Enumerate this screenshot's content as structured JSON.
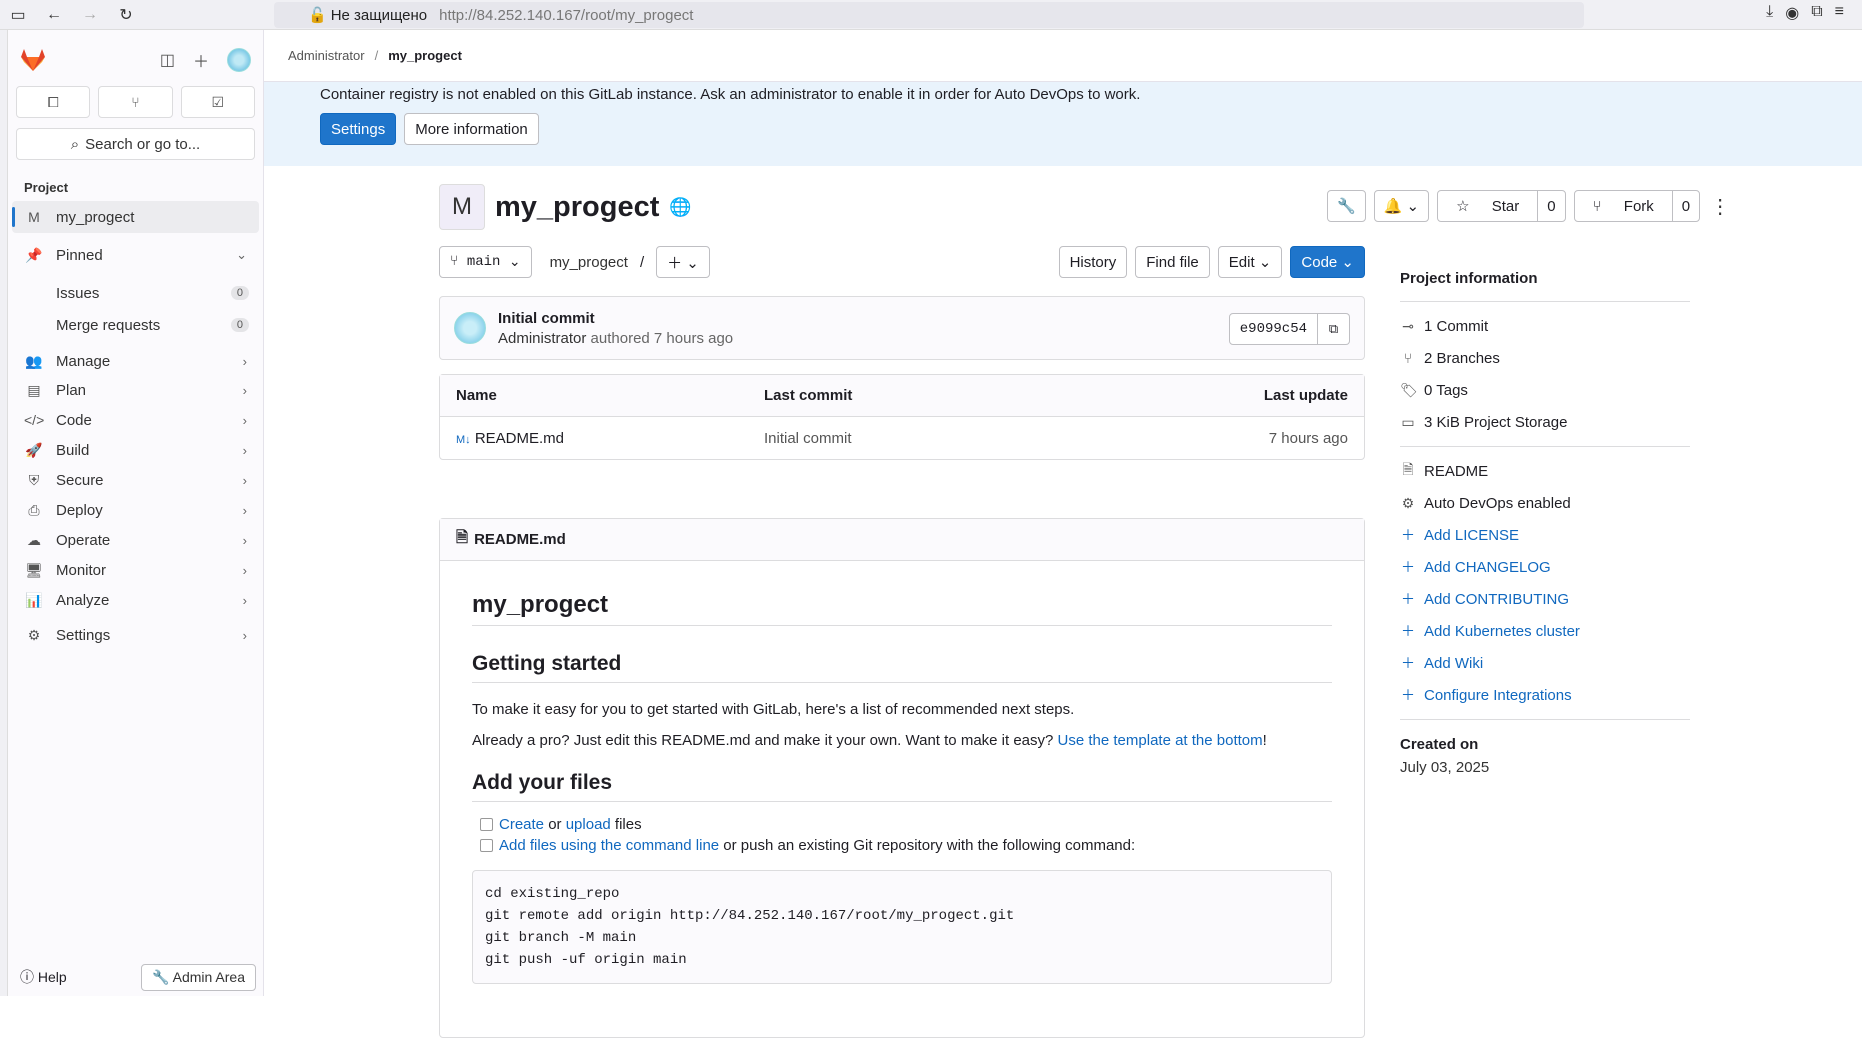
{
  "browser": {
    "security_label": "Не защищено",
    "url": "http://84.252.140.167/root/my_progect"
  },
  "sidebar": {
    "search": "Search or go to...",
    "section": "Project",
    "project_item": "my_progect",
    "project_initial": "M",
    "pinned": "Pinned",
    "issues": "Issues",
    "issues_count": "0",
    "mrs": "Merge requests",
    "mrs_count": "0",
    "nav": [
      "Manage",
      "Plan",
      "Code",
      "Build",
      "Secure",
      "Deploy",
      "Operate",
      "Monitor",
      "Analyze",
      "Settings"
    ],
    "help": "Help",
    "admin": "Admin Area"
  },
  "breadcrumb": {
    "root": "Administrator",
    "current": "my_progect"
  },
  "banner": {
    "text": "Container registry is not enabled on this GitLab instance. Ask an administrator to enable it in order for Auto DevOps to work.",
    "settings": "Settings",
    "more": "More information"
  },
  "project": {
    "initial": "M",
    "name": "my_progect",
    "star": "Star",
    "star_count": "0",
    "fork": "Fork",
    "fork_count": "0"
  },
  "toolbar": {
    "branch": "main",
    "path": "my_progect",
    "path_sep": "/",
    "history": "History",
    "find_file": "Find file",
    "edit": "Edit",
    "code": "Code"
  },
  "commit": {
    "title": "Initial commit",
    "author": "Administrator",
    "authored": "authored 7 hours ago",
    "sha": "e9099c54"
  },
  "files": {
    "headers": [
      "Name",
      "Last commit",
      "Last update"
    ],
    "rows": [
      {
        "name": "README.md",
        "commit": "Initial commit",
        "updated": "7 hours ago"
      }
    ]
  },
  "readme": {
    "filename": "README.md",
    "h1": "my_progect",
    "h2_start": "Getting started",
    "p1": "To make it easy for you to get started with GitLab, here's a list of recommended next steps.",
    "p2_pre": "Already a pro? Just edit this README.md and make it your own. Want to make it easy? ",
    "p2_link": "Use the template at the bottom",
    "p2_post": "!",
    "h2_files": "Add your files",
    "create": "Create",
    "or": " or ",
    "upload": "upload",
    "files": " files",
    "cmdline": "Add files using the command line",
    "cmd_post": " or push an existing Git repository with the following command:",
    "code_lines": [
      "cd existing_repo",
      "git remote add origin http://84.252.140.167/root/my_progect.git",
      "git branch -M main",
      "git push -uf origin main"
    ]
  },
  "info": {
    "title": "Project information",
    "stats": [
      "1 Commit",
      "2 Branches",
      "0 Tags",
      "3 KiB Project Storage"
    ],
    "readme": "README",
    "devops": "Auto DevOps enabled",
    "links": [
      "Add LICENSE",
      "Add CHANGELOG",
      "Add CONTRIBUTING",
      "Add Kubernetes cluster",
      "Add Wiki",
      "Configure Integrations"
    ],
    "created_label": "Created on",
    "created_date": "July 03, 2025"
  },
  "colors": {
    "accent": "#1f75cb",
    "banner": "#e9f3fc",
    "link": "#1068bf"
  }
}
